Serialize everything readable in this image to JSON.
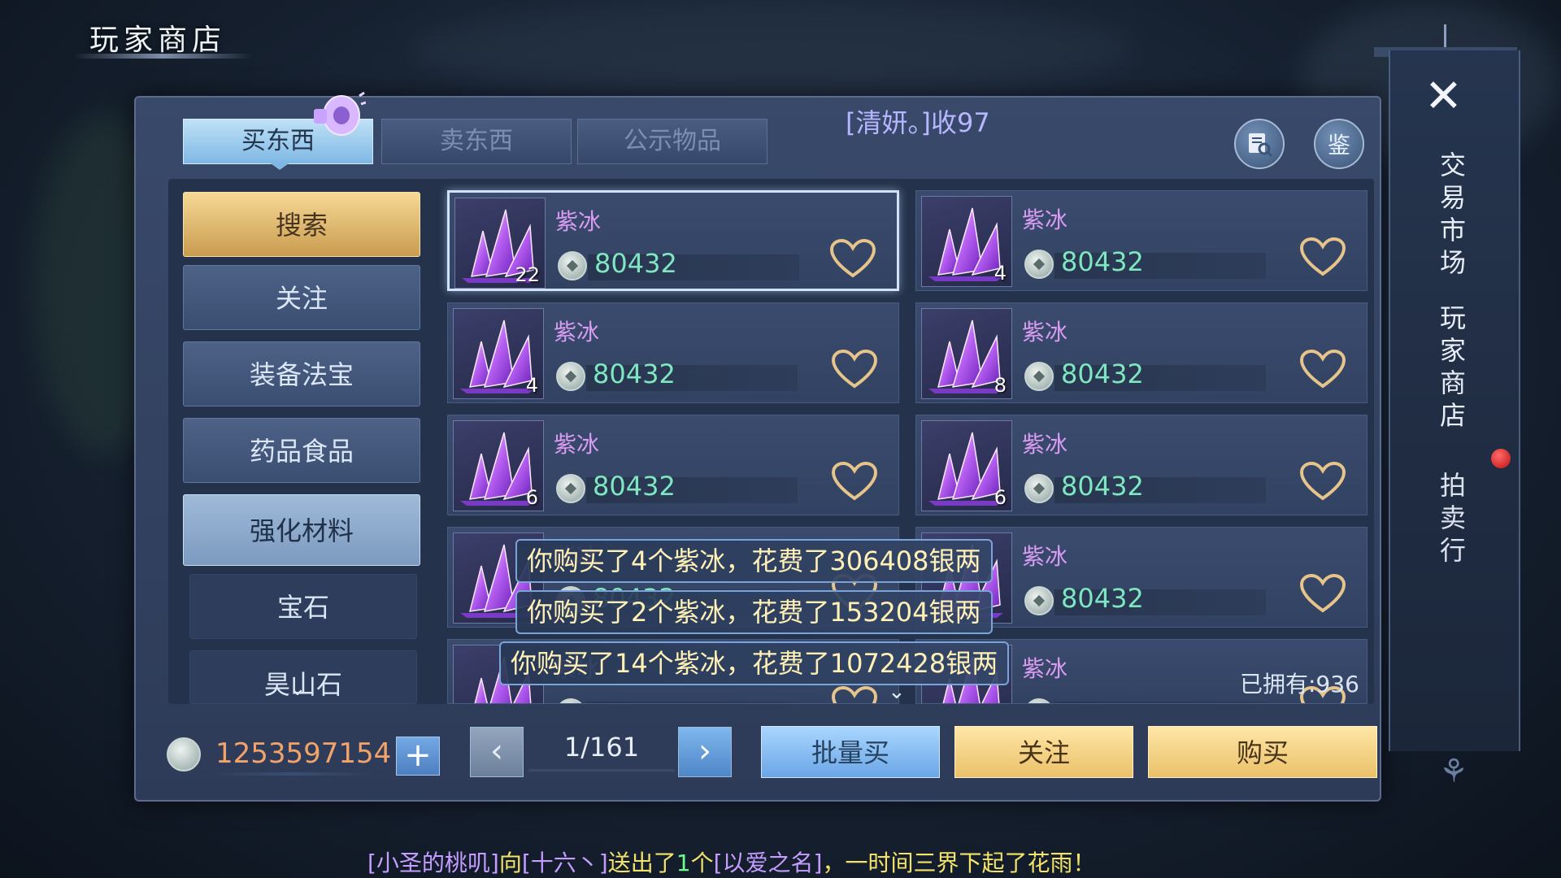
{
  "screen_title": "玩家商店",
  "tabs": [
    {
      "label": "买东西",
      "active": true
    },
    {
      "label": "卖东西",
      "active": false
    },
    {
      "label": "公示物品",
      "active": false
    }
  ],
  "marquee": "[清妍。]收97",
  "top_icons": {
    "search_icon": "magnifier-scroll-icon",
    "appraise_label": "鉴"
  },
  "sidebar": [
    {
      "label": "搜索",
      "state": "active"
    },
    {
      "label": "关注",
      "state": "normal"
    },
    {
      "label": "装备法宝",
      "state": "normal"
    },
    {
      "label": "药品食品",
      "state": "normal"
    },
    {
      "label": "强化材料",
      "state": "selected"
    },
    {
      "label": "宝石",
      "state": "plain"
    },
    {
      "label": "昊山石",
      "state": "plain"
    }
  ],
  "items": [
    {
      "name": "紫冰",
      "count": "22",
      "price": "80432",
      "selected": true
    },
    {
      "name": "紫冰",
      "count": "4",
      "price": "80432",
      "selected": false
    },
    {
      "name": "紫冰",
      "count": "4",
      "price": "80432",
      "selected": false
    },
    {
      "name": "紫冰",
      "count": "8",
      "price": "80432",
      "selected": false
    },
    {
      "name": "紫冰",
      "count": "6",
      "price": "80432",
      "selected": false
    },
    {
      "name": "紫冰",
      "count": "6",
      "price": "80432",
      "selected": false
    },
    {
      "name": "紫冰",
      "count": "",
      "price": "80432",
      "selected": false
    },
    {
      "name": "紫冰",
      "count": "",
      "price": "80432",
      "selected": false
    },
    {
      "name": "紫冰",
      "count": "",
      "price": "",
      "selected": false
    },
    {
      "name": "紫冰",
      "count": "",
      "price": "",
      "selected": false
    }
  ],
  "owned": "已拥有:936",
  "toasts": [
    "你购买了4个紫冰，花费了306408银两",
    "你购买了2个紫冰，花费了153204银两",
    "你购买了14个紫冰，花费了1072428银两"
  ],
  "wallet": {
    "amount": "1253597154",
    "add_label": "+"
  },
  "pagination": {
    "current": "1/161",
    "prev": "‹",
    "next": "›"
  },
  "actions": {
    "batch_buy": "批量买",
    "follow": "关注",
    "buy": "购买"
  },
  "right_panel": {
    "close": "✕",
    "nav": [
      "交易市场",
      "玩家商店",
      "拍卖行"
    ]
  },
  "chat": {
    "player": "[小圣的桃叽]",
    "to_word": "向",
    "target": "[十六丶]",
    "sent": "送出了",
    "num": "1",
    "unit": "个",
    "gift": "[以爱之名]",
    "tail": "，一时间三界下起了花雨！"
  },
  "colors": {
    "accent_gold": "#eac16a",
    "accent_blue": "#6aa6e6",
    "item_name": "#d99cf2",
    "price": "#7ee6c0",
    "money": "#f2a36a"
  }
}
